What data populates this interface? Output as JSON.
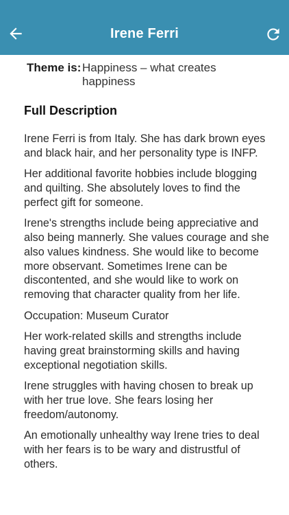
{
  "header": {
    "title": "Irene Ferri",
    "back_icon": "arrow-left-icon",
    "refresh_icon": "refresh-icon",
    "background_color": "#3a8fb1"
  },
  "theme": {
    "label": "Theme is:",
    "value": "Happiness – what creates happiness"
  },
  "description": {
    "heading": "Full Description",
    "paragraphs": [
      "Irene Ferri is from Italy. She has dark brown eyes and black hair, and her personality type is INFP.",
      "Her additional favorite hobbies include blogging and quilting. She absolutely loves to find the perfect gift for someone.",
      "Irene's strengths include being appreciative and also being mannerly. She values courage and she also values kindness. She would like to become more observant. Sometimes Irene can be discontented, and she would like to work on removing that character quality from her life.",
      "Occupation: Museum Curator",
      "Her work-related skills and strengths include having great brainstorming skills and having exceptional negotiation skills.",
      "Irene struggles with having chosen to break up with her true love. She fears losing her freedom/autonomy.",
      "An emotionally unhealthy way Irene tries to deal with her fears is to be wary and distrustful of others."
    ]
  }
}
